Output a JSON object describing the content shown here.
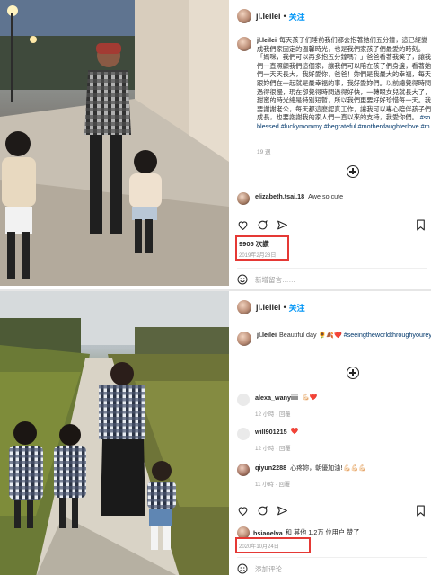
{
  "posts": [
    {
      "username": "jl.leilei",
      "dot": "•",
      "follow": "关注",
      "caption_user": "jl.leilei",
      "caption_text": "每天孩子们睡前我们都会抱著她们五分鐘，這已經變成我們家固定的溫馨時光，也是我們家孩子們最愛的時刻。「媽咪，我們可以再多抱五分鐘嗎？」爸爸看著我笑了，讓我們一直照顧我們這個家，讓我們可以陪在孩子們身邊，看著她們一天天長大，我好愛你，爸爸！妳們是我最大的幸福，每天跟妳們在一起就是最幸福的事，我好愛妳們。以前總覺得時間過得很慢，現在卻覺得時間過得好快，一轉眼女兒就長大了，甜蜜的時光總是特別短暫，所以我們更要好好珍惜每一天。我要謝謝老公，每天都這麼認真工作，讓我可以專心陪伴孩子們成長，也要謝謝我的家人們一直以來的支持，我愛你們。",
      "caption_tags": "#soblessed #luckymommy #begrateful #motherdaughterlove #mylittlesweetheart #慢慢長大",
      "caption_time": "19 週",
      "comments": [
        {
          "user": "elizabeth.tsai.18",
          "text": "Awe so cute"
        }
      ],
      "likes": "9905 次讚",
      "date": "2019年2月28日",
      "add_comment": "新增留言……"
    },
    {
      "username": "jl.leilei",
      "dot": "•",
      "follow": "关注",
      "caption_user": "jl.leilei",
      "caption_text": "Beautiful day",
      "caption_emoji": "🌻🍂❤️",
      "caption_tags": "#seeingtheworldthroughyourey",
      "comments": [
        {
          "user": "alexa_wanyiiii",
          "text": "💪🏻❤️",
          "meta": "12 小時 · 回覆"
        },
        {
          "user": "will901215",
          "text": "❤️",
          "meta": "12 小時 · 回覆"
        },
        {
          "user": "qiyun2288",
          "text": "心疼妳，朝優加油!💪🏻💪🏻💪🏻",
          "meta": "11 小時 · 回覆"
        }
      ],
      "liked_by_user": "hsiaoelva",
      "liked_by_rest": "和 其他 1.2万 位用户 赞了",
      "date": "2020年10月24日",
      "add_comment": "添加评论……"
    }
  ],
  "icons": {
    "heart": "heart-icon",
    "comment": "comment-icon",
    "share": "share-icon",
    "save": "save-icon",
    "add": "plus-circle-icon",
    "emoji": "smiley-icon"
  },
  "colors": {
    "link": "#0095f6",
    "hashtag": "#00376b",
    "highlight": "#e53935",
    "like_red": "#ed4956"
  }
}
